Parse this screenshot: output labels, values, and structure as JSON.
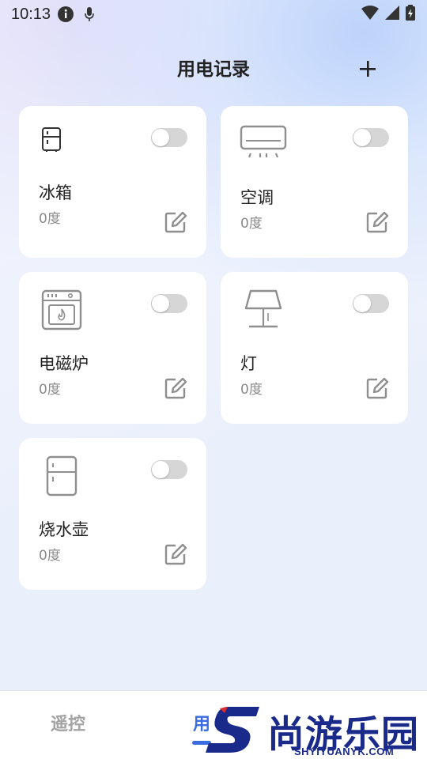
{
  "status_bar": {
    "time": "10:13",
    "icons": [
      "info-icon",
      "mic-icon",
      "wifi-icon",
      "signal-icon",
      "battery-icon"
    ]
  },
  "header": {
    "title": "用电记录",
    "add_icon": "plus-icon"
  },
  "devices": [
    {
      "name": "冰箱",
      "usage": "0度",
      "icon": "fridge-icon",
      "switch_on": false
    },
    {
      "name": "空调",
      "usage": "0度",
      "icon": "air-conditioner-icon",
      "switch_on": false
    },
    {
      "name": "电磁炉",
      "usage": "0度",
      "icon": "induction-cooker-icon",
      "switch_on": false
    },
    {
      "name": "灯",
      "usage": "0度",
      "icon": "lamp-icon",
      "switch_on": false
    },
    {
      "name": "烧水壶",
      "usage": "0度",
      "icon": "kettle-icon",
      "switch_on": false
    }
  ],
  "bottom_nav": {
    "tabs": [
      {
        "label": "遥控",
        "active": false
      },
      {
        "label": "用电记录",
        "active": true
      }
    ]
  },
  "watermark": {
    "logo_letter": "S",
    "text": "尚游乐园",
    "url": "SHYIYUANYK.COM"
  },
  "colors": {
    "accent": "#3a6de0",
    "toggle_off": "#d6d6d6",
    "icon_gray": "#8f8f8f",
    "watermark_blue": "#1a2a8a",
    "watermark_red": "#e02a2a"
  }
}
